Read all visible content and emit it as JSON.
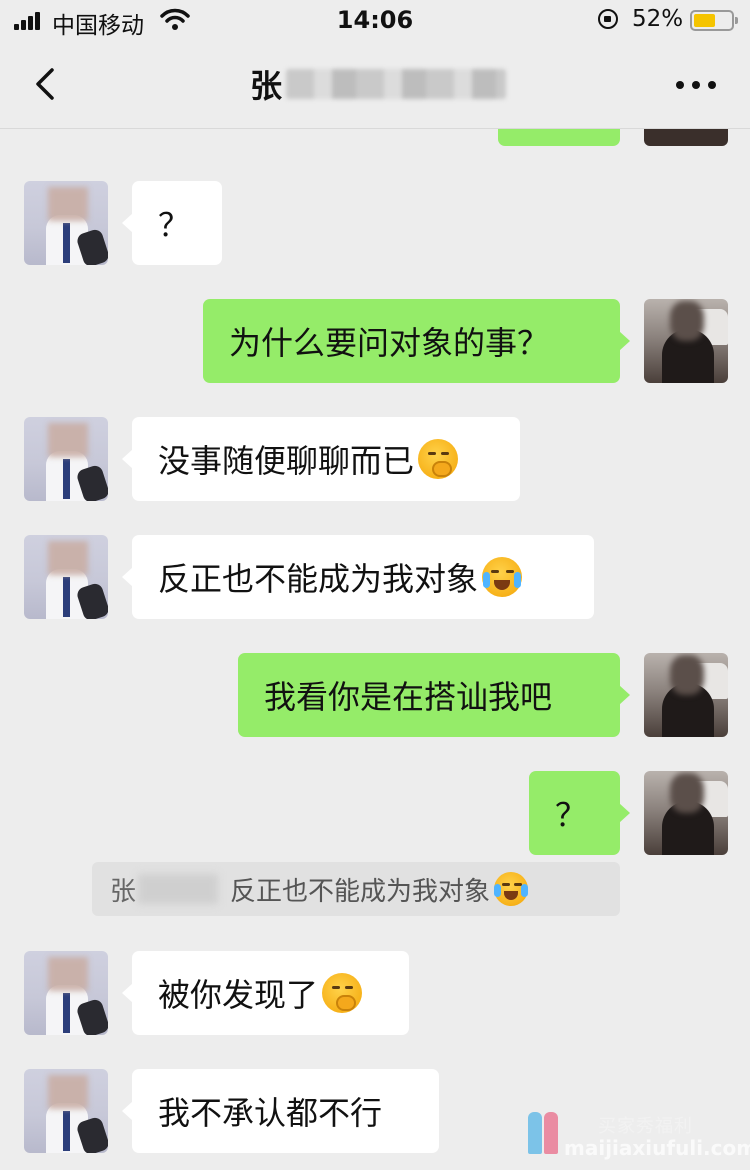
{
  "status_bar": {
    "carrier": "中国移动",
    "time": "14:06",
    "battery_percent": "52%",
    "battery_level": 0.52,
    "battery_color": "#f5c400"
  },
  "nav": {
    "title_visible": "张",
    "back_icon": "chevron-left-icon",
    "more_icon": "more-horizontal-icon"
  },
  "colors": {
    "background": "#ededed",
    "outgoing_bubble": "#95ec69",
    "incoming_bubble": "#ffffff"
  },
  "messages": [
    {
      "side": "left",
      "text": "？"
    },
    {
      "side": "right",
      "text": "为什么要问对象的事？"
    },
    {
      "side": "left",
      "text": "没事随便聊聊而已",
      "emoji": "thinking-emoji"
    },
    {
      "side": "left",
      "text": "反正也不能成为我对象",
      "emoji": "laugh-cry-emoji"
    },
    {
      "side": "right",
      "text": "我看你是在搭讪我吧"
    },
    {
      "side": "right",
      "text": "？"
    },
    {
      "side": "left",
      "text": "被你发现了",
      "emoji": "thinking-emoji"
    },
    {
      "side": "left",
      "text": "我不承认都不行"
    }
  ],
  "quote": {
    "name": "张",
    "text": "反正也不能成为我对象",
    "emoji": "laugh-cry-emoji"
  },
  "watermark": {
    "line1": "买家秀福利",
    "line2": "maijiaxiufuli.com"
  }
}
